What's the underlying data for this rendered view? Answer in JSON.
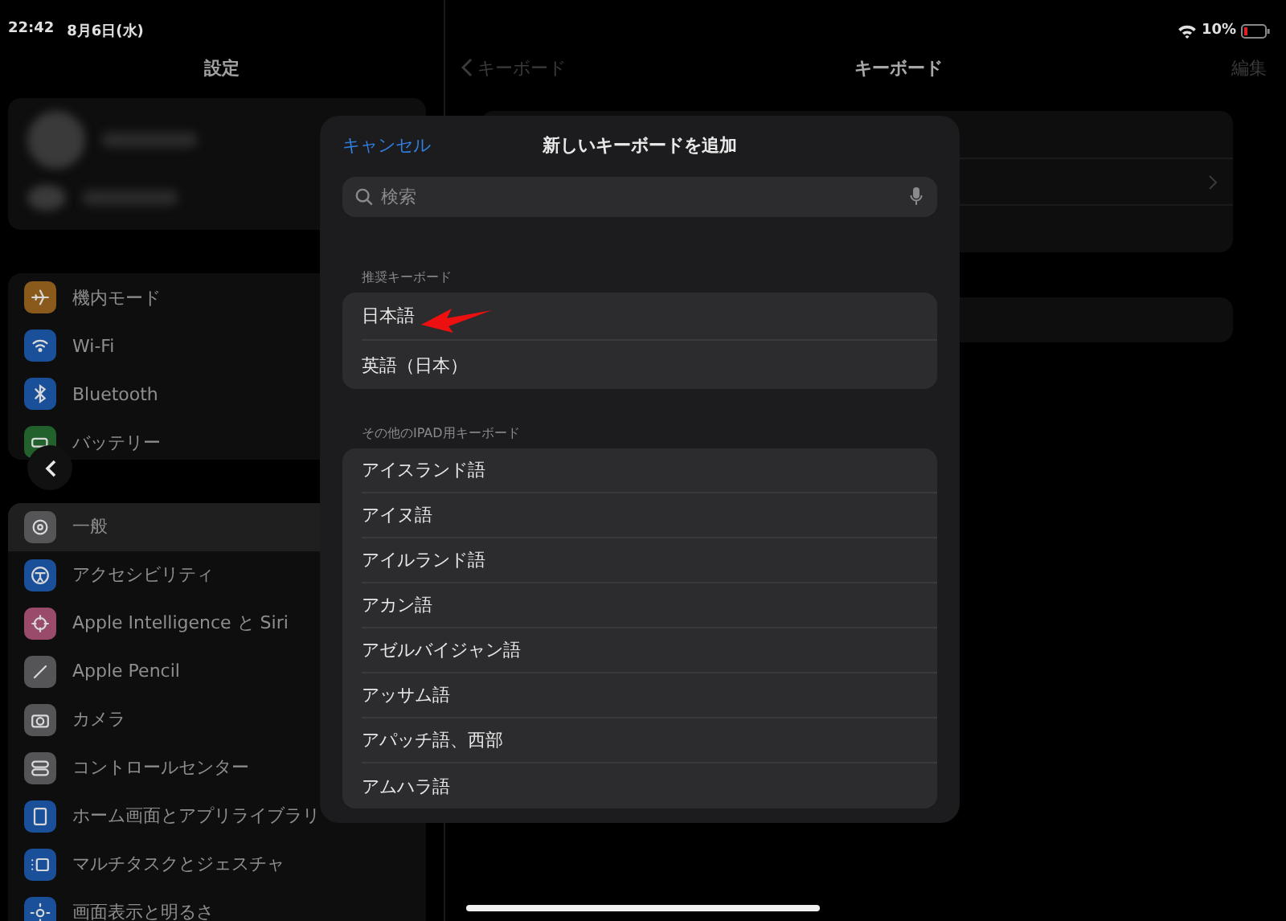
{
  "status_bar": {
    "time": "22:42",
    "date": "8月6日(水)",
    "battery": "10%"
  },
  "sidebar": {
    "title": "設定",
    "groups": [
      {
        "items": [
          {
            "kind": "airplane",
            "label": "機内モード",
            "color": "#8a5a1c",
            "selected": false
          },
          {
            "kind": "wifi",
            "label": "Wi-Fi",
            "color": "#1a4f9a",
            "selected": false
          },
          {
            "kind": "bluetooth",
            "label": "Bluetooth",
            "color": "#1a4f9a",
            "selected": false
          },
          {
            "kind": "battery",
            "label": "バッテリー",
            "color": "#22602c",
            "selected": false
          }
        ]
      },
      {
        "items": [
          {
            "kind": "gear",
            "label": "一般",
            "color": "#555558",
            "selected": true
          },
          {
            "kind": "accessibility",
            "label": "アクセシビリティ",
            "color": "#1a4f9a",
            "selected": false
          },
          {
            "kind": "sparkle",
            "label": "Apple Intelligence と Siri",
            "color": "#9a4a6a",
            "selected": false
          },
          {
            "kind": "pencil",
            "label": "Apple Pencil",
            "color": "#555558",
            "selected": false
          },
          {
            "kind": "camera",
            "label": "カメラ",
            "color": "#555558",
            "selected": false
          },
          {
            "kind": "toggles",
            "label": "コントロールセンター",
            "color": "#555558",
            "selected": false
          },
          {
            "kind": "home",
            "label": "ホーム画面とアプリライブラリ",
            "color": "#1a4f9a",
            "selected": false
          },
          {
            "kind": "multitask",
            "label": "マルチタスクとジェスチャ",
            "color": "#1a4f9a",
            "selected": false
          },
          {
            "kind": "sun",
            "label": "画面表示と明るさ",
            "color": "#1a4f9a",
            "selected": false
          }
        ]
      }
    ]
  },
  "detail": {
    "back": "キーボード",
    "title": "キーボード",
    "action": "編集"
  },
  "modal": {
    "cancel": "キャンセル",
    "title": "新しいキーボードを追加",
    "search": {
      "placeholder": "検索"
    },
    "sections": [
      {
        "header": "推奨キーボード",
        "items": [
          "日本語",
          "英語（日本）"
        ]
      },
      {
        "header": "その他のIPAD用キーボード",
        "items": [
          "アイスランド語",
          "アイヌ語",
          "アイルランド語",
          "アカン語",
          "アゼルバイジャン語",
          "アッサム語",
          "アパッチ語、西部",
          "アムハラ語"
        ]
      }
    ]
  }
}
